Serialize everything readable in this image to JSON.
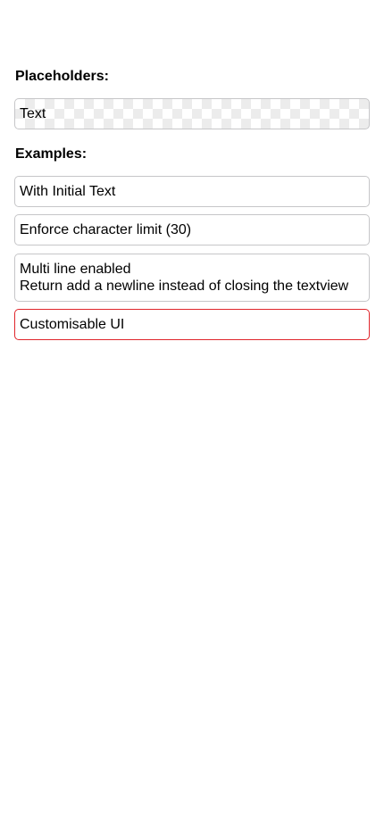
{
  "sections": {
    "placeholders_title": "Placeholders:",
    "examples_title": "Examples:"
  },
  "fields": {
    "placeholder_text": "Text",
    "initial_text": "With Initial Text",
    "char_limit": "Enforce character limit (30)",
    "multiline": {
      "line1": "Multi line enabled",
      "line2": "Return add a newline instead of closing the textview"
    },
    "customisable": "Customisable UI"
  },
  "colors": {
    "field_border": "#c6c6c8",
    "custom_border": "#e0252b",
    "background": "#ffffff"
  }
}
